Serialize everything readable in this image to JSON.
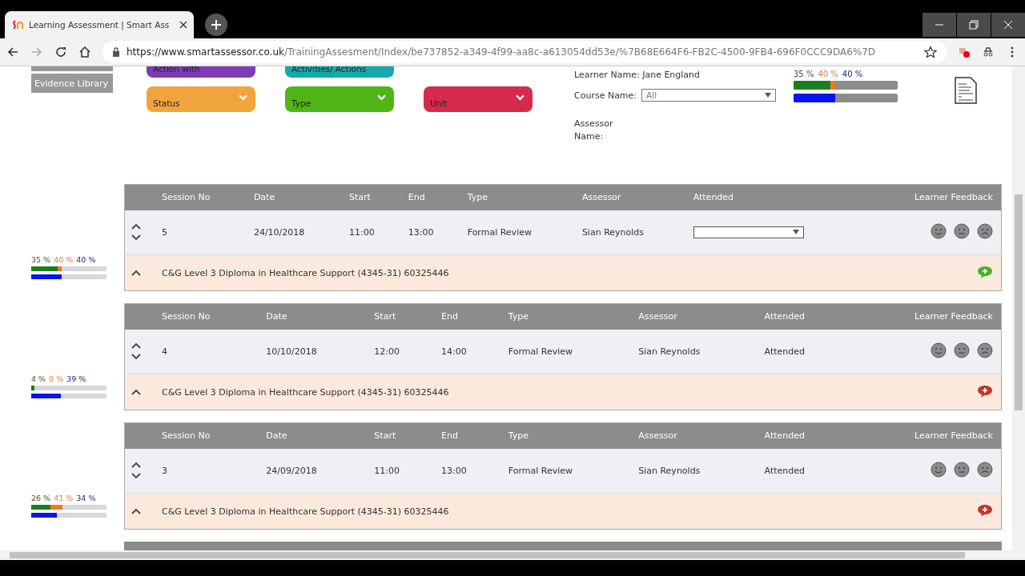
{
  "browser": {
    "tab_title": "Learning Assessment | Smart Ass",
    "url_host": "https://www.smartassessor.co.uk",
    "url_path": "/TrainingAssesment/Index/be737852-a349-4f99-aa8c-a613054dd53e/%7B68E664F6-FB2C-4500-9FB4-696F0CCC9DA6%7D"
  },
  "sidebar": {
    "items": [
      {
        "label": "Evidence Library"
      }
    ]
  },
  "filter_rows": [
    [
      {
        "label": "Action with",
        "color": "#7e3bb5"
      },
      {
        "label": "Activities/ Actions",
        "color": "#17a9a9"
      }
    ],
    [
      {
        "label": "Status",
        "color": "#f0a53c"
      },
      {
        "label": "Type",
        "color": "#50b517"
      },
      {
        "label": "Unit",
        "color": "#d62a4c"
      }
    ]
  ],
  "learner": {
    "learner_name": "Learner Name: Jane England",
    "course_label": "Course Name:",
    "course_value": "All",
    "assessor_label": "Assessor Name:"
  },
  "overall_progress": {
    "labels": [
      "35 %",
      "40 %",
      "40 %"
    ],
    "green": {
      "level": 0.35
    },
    "orange": {
      "level": 0.4
    },
    "blue": {
      "level": 0.4
    }
  },
  "sessions": [
    {
      "progress": {
        "labels": [
          "35 %",
          "40 %",
          "40 %"
        ],
        "green": {
          "level": 0.35
        },
        "orange": {
          "level": 0.4
        },
        "blue": {
          "level": 0.4
        }
      },
      "columns": [
        "Session No",
        "Date",
        "Start",
        "End",
        "Type",
        "Assessor",
        "Attended",
        "Learner Feedback"
      ],
      "session_no": "5",
      "date": "24/10/2018",
      "start": "11:00",
      "end": "13:00",
      "type": "Formal Review",
      "assessor": "Sian Reynolds",
      "attended": {
        "kind": "dropdown"
      },
      "course": "C&G Level 3 Diploma in Healthcare Support (4345-31) 60325446",
      "feedback_given": false
    },
    {
      "progress": {
        "labels": [
          "4 %",
          "0 %",
          "39 %"
        ],
        "green": {
          "level": 0.04
        },
        "orange": {
          "level": 0.0
        },
        "blue": {
          "level": 0.39
        }
      },
      "columns": [
        "Session No",
        "Date",
        "Start",
        "End",
        "Type",
        "Assessor",
        "Attended",
        "Learner Feedback"
      ],
      "session_no": "4",
      "date": "10/10/2018",
      "start": "12:00",
      "end": "14:00",
      "type": "Formal Review",
      "assessor": "Sian Reynolds",
      "attended": {
        "kind": "text",
        "text": "Attended"
      },
      "course": "C&G Level 3 Diploma in Healthcare Support (4345-31) 60325446",
      "feedback_given": true
    },
    {
      "progress": {
        "labels": [
          "26 %",
          "41 %",
          "34 %"
        ],
        "green": {
          "level": 0.26
        },
        "orange": {
          "level": 0.41
        },
        "blue": {
          "level": 0.34
        }
      },
      "columns": [
        "Session No",
        "Date",
        "Start",
        "End",
        "Type",
        "Assessor",
        "Attended",
        "Learner Feedback"
      ],
      "session_no": "3",
      "date": "24/09/2018",
      "start": "11:00",
      "end": "13:00",
      "type": "Formal Review",
      "assessor": "Sian Reynolds",
      "attended": {
        "kind": "text",
        "text": "Attended"
      },
      "course": "C&G Level 3 Diploma in Healthcare Support (4345-31) 60325446",
      "feedback_given": true
    }
  ]
}
